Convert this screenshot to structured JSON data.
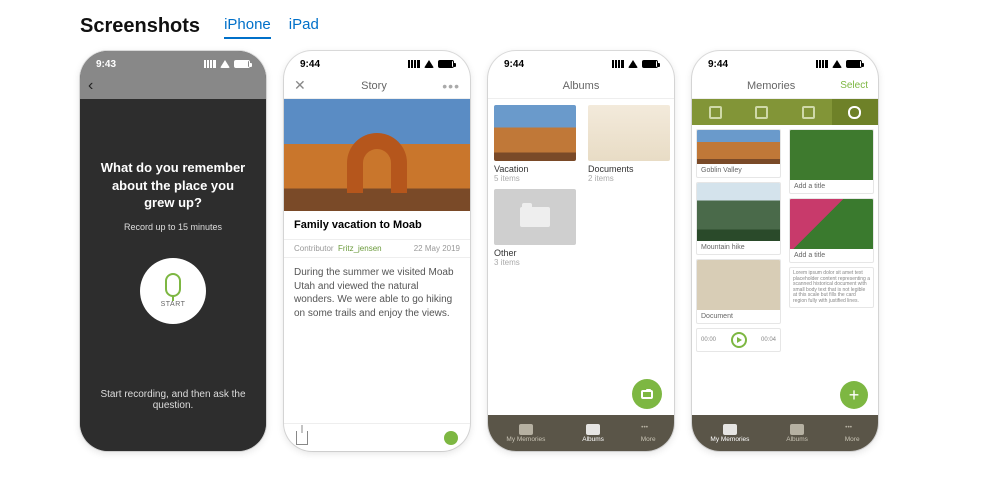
{
  "header": {
    "title": "Screenshots"
  },
  "tabs": [
    "iPhone",
    "iPad"
  ],
  "active_tab": 0,
  "screens": {
    "s1": {
      "time": "9:43",
      "question": "What do you remember about the place you grew up?",
      "hint": "Record up to 15 minutes",
      "start_label": "START",
      "footer": "Start recording, and then ask the question."
    },
    "s2": {
      "time": "9:44",
      "nav_title": "Story",
      "story_title": "Family vacation to Moab",
      "contributor_label": "Contributor",
      "contributor": "Fritz_jensen",
      "date": "22 May 2019",
      "description": "During the summer we visited Moab Utah and viewed the natural wonders. We were able to go hiking on some trails and enjoy the views."
    },
    "s3": {
      "time": "9:44",
      "nav_title": "Albums",
      "albums": [
        {
          "name": "Vacation",
          "count": "5 items"
        },
        {
          "name": "Documents",
          "count": "2 items"
        },
        {
          "name": "Other",
          "count": "3 items"
        }
      ],
      "tabbar": [
        "My Memories",
        "Albums",
        "More"
      ],
      "tabbar_active": 1
    },
    "s4": {
      "time": "9:44",
      "nav_title": "Memories",
      "select_label": "Select",
      "cards": {
        "goblin": "Goblin Valley",
        "add": "Add a title",
        "mtn": "Mountain hike",
        "doc": "Document",
        "audio_start": "00:00",
        "audio_end": "00:04"
      },
      "tabbar": [
        "My Memories",
        "Albums",
        "More"
      ],
      "tabbar_active": 0
    }
  }
}
